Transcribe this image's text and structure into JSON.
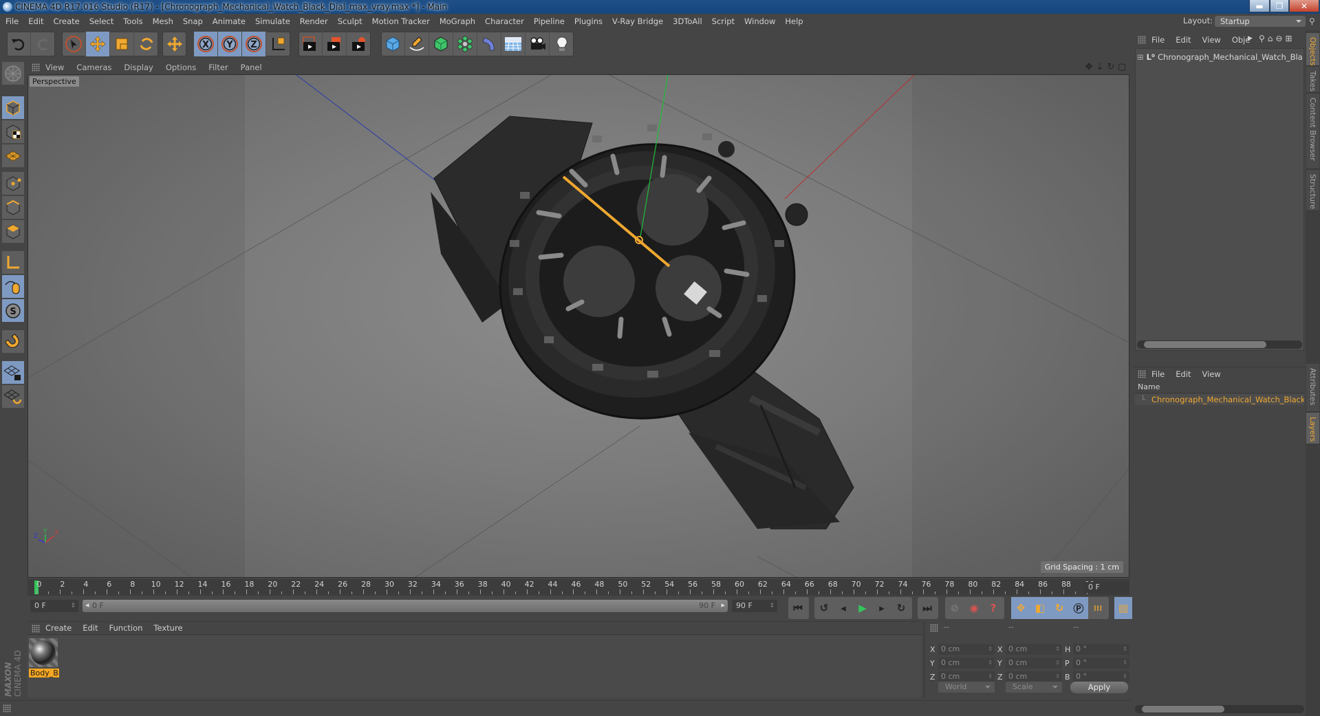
{
  "window": {
    "title": "CINEMA 4D R17.016 Studio (R17) - [Chronograph_Mechanical_Watch_Black_Dial_max_vray.max *] - Main",
    "controls": [
      "minimize",
      "maximize",
      "close"
    ]
  },
  "menubar": [
    "File",
    "Edit",
    "Create",
    "Select",
    "Tools",
    "Mesh",
    "Snap",
    "Animate",
    "Simulate",
    "Render",
    "Sculpt",
    "Motion Tracker",
    "MoGraph",
    "Character",
    "Pipeline",
    "Plugins",
    "V-Ray Bridge",
    "3DToAll",
    "Script",
    "Window",
    "Help"
  ],
  "layout": {
    "label": "Layout:",
    "value": "Startup"
  },
  "toolbar": {
    "groups": [
      [
        "undo-icon",
        "redo-icon"
      ],
      [
        "select-arrow-icon",
        "move-icon",
        "scale-icon",
        "rotate-icon"
      ],
      [
        "add-object-move-icon"
      ],
      [
        "x-axis-lock-icon",
        "y-axis-lock-icon",
        "z-axis-lock-icon",
        "coordinate-system-icon"
      ],
      [
        "render-view-icon",
        "render-picture-viewer-icon",
        "render-settings-icon"
      ],
      [
        "cube-primitive-icon",
        "pen-spline-icon",
        "subdivision-nurbs-icon",
        "mograph-cloner-icon",
        "deformer-bend-icon",
        "floor-scene-icon",
        "camera-icon",
        "light-icon"
      ]
    ],
    "active": [
      "move-icon",
      "x-axis-lock-icon",
      "y-axis-lock-icon",
      "z-axis-lock-icon"
    ]
  },
  "left_toolbar": [
    "make-editable-icon",
    "model-mode-icon",
    "texture-mode-icon",
    "workplane-icon",
    "points-mode-icon",
    "edges-mode-icon",
    "polygons-mode-icon",
    "axis-mode-icon",
    "tweak-mode-icon",
    "solo-icon",
    "snap-magnet-icon",
    "workplane-lock-icon",
    "workplane-grid-icon"
  ],
  "viewport": {
    "menu": [
      "View",
      "Cameras",
      "Display",
      "Options",
      "Filter",
      "Panel"
    ],
    "label": "Perspective",
    "grid_spacing": "Grid Spacing : 1 cm",
    "axis_labels": {
      "x": "X",
      "y": "Y",
      "z": "Z"
    },
    "nav_icons": [
      "move-view-icon",
      "zoom-view-icon",
      "rotate-view-icon",
      "toggle-layout-icon"
    ]
  },
  "timeline": {
    "ticks": [
      0,
      2,
      4,
      6,
      8,
      10,
      12,
      14,
      16,
      18,
      20,
      22,
      24,
      26,
      28,
      30,
      32,
      34,
      36,
      38,
      40,
      42,
      44,
      46,
      48,
      50,
      52,
      54,
      56,
      58,
      60,
      62,
      64,
      66,
      68,
      70,
      72,
      74,
      76,
      78,
      80,
      82,
      84,
      86,
      88,
      90
    ],
    "current_frame": "0 F",
    "start_field": "0 F",
    "slider_start": "0 F",
    "slider_end": "90 F",
    "end_field": "90 F",
    "right_frame_field": "0 F",
    "min": 0,
    "max": 90,
    "current": 0
  },
  "playback": {
    "buttons": [
      "go-to-start-icon",
      "previous-key-icon",
      "previous-frame-icon",
      "play-icon",
      "next-frame-icon",
      "next-key-icon",
      "go-to-end-icon"
    ],
    "record": [
      "autokey-disabled-icon",
      "record-active-icon",
      "record-help-icon"
    ],
    "keys": [
      "key-position-icon",
      "key-scale-icon",
      "key-rotation-icon",
      "key-parameter-icon",
      "key-pla-icon"
    ],
    "timeline_icon": "timeline-window-icon"
  },
  "material_manager": {
    "menu": [
      "Create",
      "Edit",
      "Function",
      "Texture"
    ],
    "materials": [
      {
        "name": "Body_Bl"
      }
    ]
  },
  "coordinates": {
    "headers": [
      "--",
      "--",
      "--"
    ],
    "rows": [
      {
        "a": "X",
        "pos": "0 cm",
        "b": "X",
        "size": "0 cm",
        "c": "H",
        "rot": "0 °"
      },
      {
        "a": "Y",
        "pos": "0 cm",
        "b": "Y",
        "size": "0 cm",
        "c": "P",
        "rot": "0 °"
      },
      {
        "a": "Z",
        "pos": "0 cm",
        "b": "Z",
        "size": "0 cm",
        "c": "B",
        "rot": "0 °"
      }
    ],
    "mode": "World",
    "transform": "Scale",
    "apply": "Apply"
  },
  "object_manager": {
    "menu": [
      "File",
      "Edit",
      "View",
      "Obje"
    ],
    "objects": [
      {
        "name": "Chronograph_Mechanical_Watch_Black_Dial_max_vray"
      }
    ]
  },
  "layer_manager": {
    "menu": [
      "File",
      "Edit",
      "View"
    ],
    "column": "Name",
    "layers": [
      {
        "name": "Chronograph_Mechanical_Watch_Black_Dial",
        "color": "#5b3a8a"
      }
    ]
  },
  "side_tabs": {
    "top": [
      {
        "label": "Objects",
        "active": true
      },
      {
        "label": "Takes",
        "active": false
      },
      {
        "label": "Content Browser",
        "active": false
      },
      {
        "label": "Structure",
        "active": false
      }
    ],
    "bottom": [
      {
        "label": "Attributes",
        "active": false
      },
      {
        "label": "Layers",
        "active": true
      }
    ]
  },
  "branding": {
    "maxon": "MAXON",
    "product": "CINEMA 4D"
  },
  "colors": {
    "accent_orange": "#f0a830",
    "active_blue": "#7f9ac2",
    "play_green": "#34c55a",
    "record_red": "#d9534f"
  }
}
